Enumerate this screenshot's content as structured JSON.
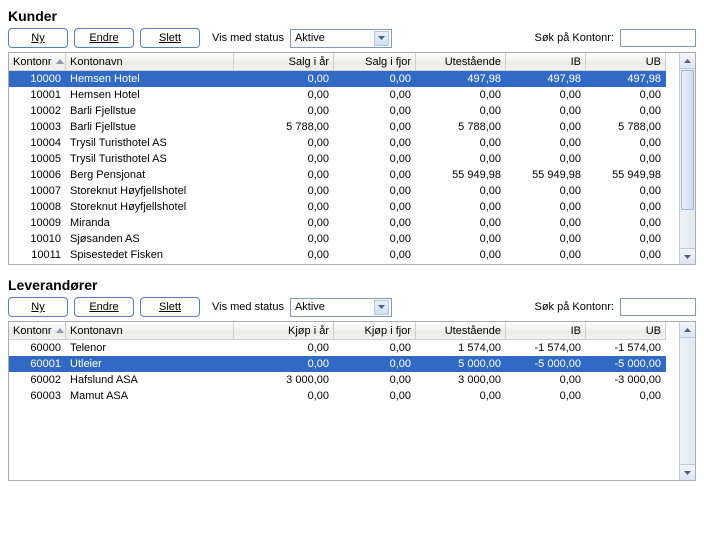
{
  "sections": {
    "customers": {
      "title": "Kunder",
      "buttons": {
        "new": "Ny",
        "edit": "Endre",
        "delete": "Slett"
      },
      "statusLabel": "Vis med status",
      "statusValue": "Aktive",
      "searchLabel": "Søk på Kontonr:",
      "columns": [
        "Kontonr",
        "Kontonavn",
        "Salg i år",
        "Salg i fjor",
        "Utestående",
        "IB",
        "UB"
      ],
      "selectedIndex": 0,
      "rows": [
        {
          "id": "10000",
          "name": "Hemsen Hotel",
          "c1": "0,00",
          "c2": "0,00",
          "c3": "497,98",
          "c4": "497,98",
          "c5": "497,98"
        },
        {
          "id": "10001",
          "name": "Hemsen Hotel",
          "c1": "0,00",
          "c2": "0,00",
          "c3": "0,00",
          "c4": "0,00",
          "c5": "0,00"
        },
        {
          "id": "10002",
          "name": "Barli Fjellstue",
          "c1": "0,00",
          "c2": "0,00",
          "c3": "0,00",
          "c4": "0,00",
          "c5": "0,00"
        },
        {
          "id": "10003",
          "name": "Barli Fjellstue",
          "c1": "5 788,00",
          "c2": "0,00",
          "c3": "5 788,00",
          "c4": "0,00",
          "c5": "5 788,00"
        },
        {
          "id": "10004",
          "name": "Trysil Turisthotel AS",
          "c1": "0,00",
          "c2": "0,00",
          "c3": "0,00",
          "c4": "0,00",
          "c5": "0,00"
        },
        {
          "id": "10005",
          "name": "Trysil Turisthotel AS",
          "c1": "0,00",
          "c2": "0,00",
          "c3": "0,00",
          "c4": "0,00",
          "c5": "0,00"
        },
        {
          "id": "10006",
          "name": "Berg Pensjonat",
          "c1": "0,00",
          "c2": "0,00",
          "c3": "55 949,98",
          "c4": "55 949,98",
          "c5": "55 949,98"
        },
        {
          "id": "10007",
          "name": "Storeknut Høyfjellshotel",
          "c1": "0,00",
          "c2": "0,00",
          "c3": "0,00",
          "c4": "0,00",
          "c5": "0,00"
        },
        {
          "id": "10008",
          "name": "Storeknut Høyfjellshotel",
          "c1": "0,00",
          "c2": "0,00",
          "c3": "0,00",
          "c4": "0,00",
          "c5": "0,00"
        },
        {
          "id": "10009",
          "name": "Miranda",
          "c1": "0,00",
          "c2": "0,00",
          "c3": "0,00",
          "c4": "0,00",
          "c5": "0,00"
        },
        {
          "id": "10010",
          "name": "Sjøsanden AS",
          "c1": "0,00",
          "c2": "0,00",
          "c3": "0,00",
          "c4": "0,00",
          "c5": "0,00"
        },
        {
          "id": "10011",
          "name": "Spisestedet Fisken",
          "c1": "0,00",
          "c2": "0,00",
          "c3": "0,00",
          "c4": "0,00",
          "c5": "0,00"
        }
      ]
    },
    "suppliers": {
      "title": "Leverandører",
      "buttons": {
        "new": "Ny",
        "edit": "Endre",
        "delete": "Slett"
      },
      "statusLabel": "Vis med status",
      "statusValue": "Aktive",
      "searchLabel": "Søk på Kontonr:",
      "columns": [
        "Kontonr",
        "Kontonavn",
        "Kjøp i år",
        "Kjøp i fjor",
        "Utestående",
        "IB",
        "UB"
      ],
      "selectedIndex": 1,
      "rows": [
        {
          "id": "60000",
          "name": "Telenor",
          "c1": "0,00",
          "c2": "0,00",
          "c3": "1 574,00",
          "c4": "-1 574,00",
          "c5": "-1 574,00"
        },
        {
          "id": "60001",
          "name": "Utleier",
          "c1": "0,00",
          "c2": "0,00",
          "c3": "5 000,00",
          "c4": "-5 000,00",
          "c5": "-5 000,00"
        },
        {
          "id": "60002",
          "name": "Hafslund ASA",
          "c1": "3 000,00",
          "c2": "0,00",
          "c3": "3 000,00",
          "c4": "0,00",
          "c5": "-3 000,00"
        },
        {
          "id": "60003",
          "name": "Mamut ASA",
          "c1": "0,00",
          "c2": "0,00",
          "c3": "0,00",
          "c4": "0,00",
          "c5": "0,00"
        }
      ]
    }
  }
}
